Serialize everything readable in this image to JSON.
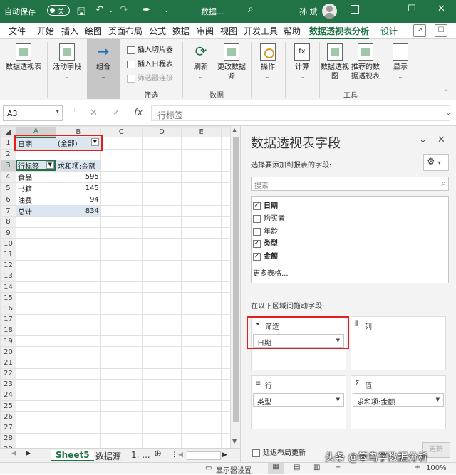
{
  "titlebar": {
    "autosave_label": "自动保存",
    "autosave_state": "关",
    "doc_title": "数据...",
    "search_glyph": "⌕",
    "user_name": "孙 斌",
    "win_min": "—",
    "win_restore": "☐",
    "win_close": "✕"
  },
  "tabs": [
    "文件",
    "开始",
    "插入",
    "绘图",
    "页面布局",
    "公式",
    "数据",
    "审阅",
    "视图",
    "开发工具",
    "帮助",
    "数据透视表分析",
    "设计"
  ],
  "ribbon": {
    "pivot_table": "数据透视表",
    "active_field": "活动字段",
    "group": "组合",
    "insert_slicer": "插入切片器",
    "insert_timeline": "插入日程表",
    "filter_connections": "筛选器连接",
    "refresh": "刷新",
    "change_source": "更改数据源",
    "actions": "操作",
    "calculations": "计算",
    "pivot_chart": "数据透视图",
    "recommended": "推荐的数据透视表",
    "show": "显示",
    "group_filter": "筛选",
    "group_data": "数据",
    "group_tools": "工具"
  },
  "formula_bar": {
    "name_box": "A3",
    "cancel": "✕",
    "enter": "✓",
    "fx": "fx",
    "content": "行标签"
  },
  "sheet": {
    "columns": [
      "A",
      "B",
      "C",
      "D",
      "E"
    ],
    "filter_field": "日期",
    "filter_value": "(全部)",
    "row_header": "行标签",
    "value_header": "求和项:金额",
    "rows": [
      {
        "label": "食品",
        "value": "595"
      },
      {
        "label": "书籍",
        "value": "145"
      },
      {
        "label": "油费",
        "value": "94"
      }
    ],
    "total_label": "总计",
    "total_value": "834"
  },
  "sheet_tabs": {
    "active": "Sheet5",
    "other": "数据源",
    "more": "1. ..."
  },
  "pane": {
    "title": "数据透视表字段",
    "choose_label": "选择要添加到报表的字段:",
    "search_placeholder": "搜索",
    "fields": [
      {
        "name": "日期",
        "checked": true
      },
      {
        "name": "购买者",
        "checked": false
      },
      {
        "name": "年龄",
        "checked": false
      },
      {
        "name": "类型",
        "checked": true
      },
      {
        "name": "金额",
        "checked": true
      }
    ],
    "more_tables": "更多表格...",
    "drag_label": "在以下区域间拖动字段:",
    "areas": {
      "filter_title": "筛选",
      "filter_item": "日期",
      "columns_title": "列",
      "rows_title": "行",
      "rows_item": "类型",
      "values_title": "值",
      "values_item": "求和项:金额"
    },
    "defer_label": "延迟布局更新",
    "update_btn": "更新"
  },
  "status": {
    "display_settings": "显示器设置",
    "zoom": "100%",
    "watermark": "头条 @笨鸟学数据分析"
  }
}
